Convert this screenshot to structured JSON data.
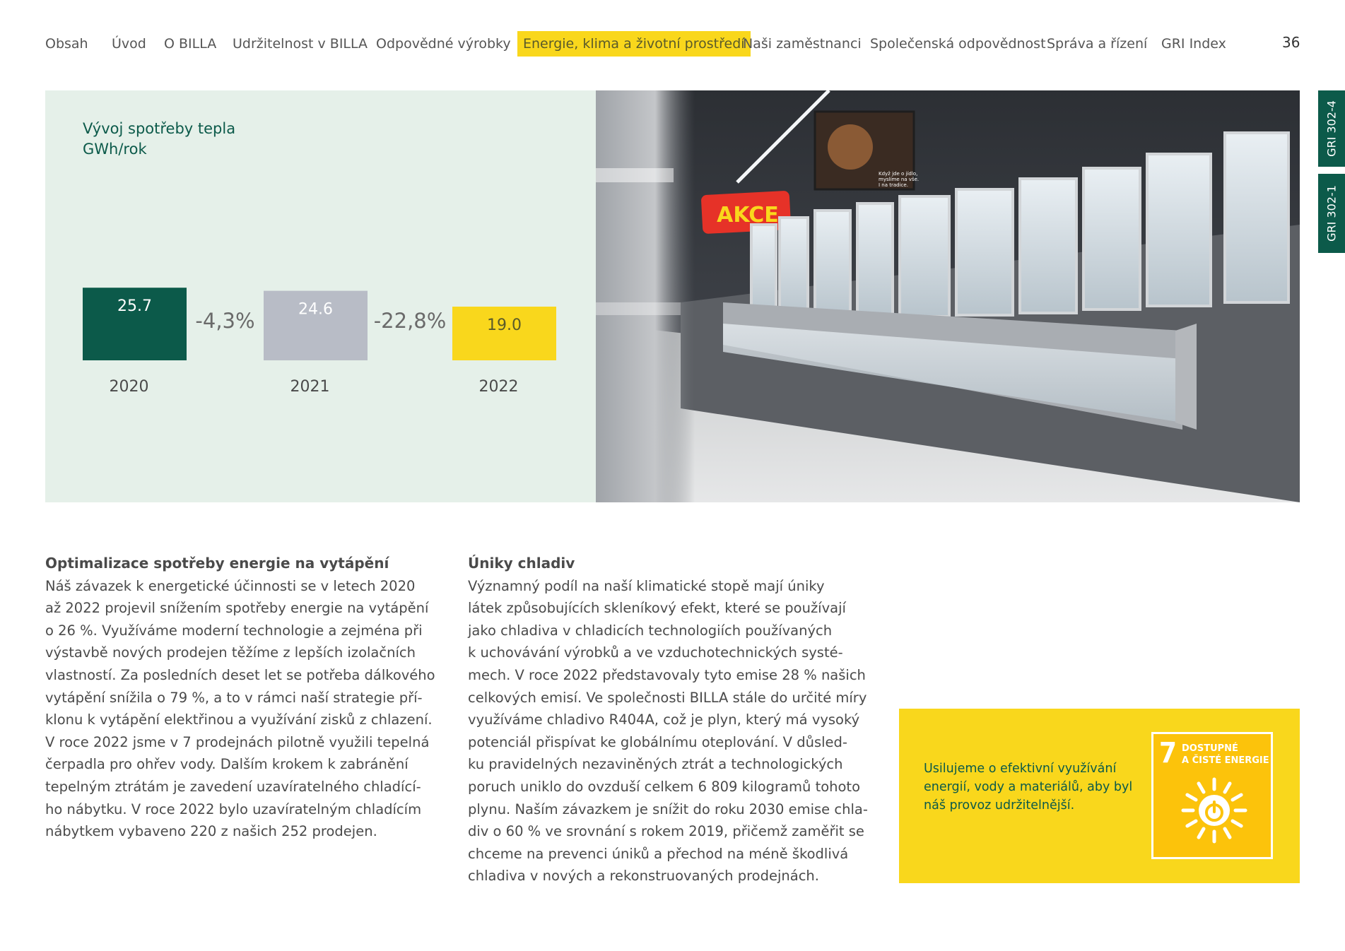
{
  "nav": {
    "items": [
      "Obsah",
      "Úvod",
      "O BILLA",
      "Udržitelnost v BILLA",
      "Odpovědné výrobky",
      "Energie, klima a životní prostředí",
      "Naši zaměstnanci",
      "Společenská odpovědnost",
      "Správa a řízení",
      "GRI Index"
    ],
    "active_index": 5,
    "page_number": "36"
  },
  "gri_tabs": [
    "GRI 302-4",
    "GRI 302-1"
  ],
  "chart_data": {
    "type": "bar",
    "title": "Vývoj spotřeby tepla",
    "ylabel": "GWh/rok",
    "categories": [
      "2020",
      "2021",
      "2022"
    ],
    "values": [
      25.7,
      24.6,
      19.0
    ],
    "value_labels": [
      "25.7",
      "24.6",
      "19.0"
    ],
    "changes": [
      "-4,3%",
      "-22,8%"
    ],
    "colors": [
      "#0c5a4a",
      "#b8bcc6",
      "#f9d71c"
    ],
    "label_colors": [
      "#ffffff",
      "#ffffff",
      "#5a5a2a"
    ]
  },
  "photo": {
    "sign_text": "AKCE",
    "screen_lines": [
      "Když jde o jídlo,",
      "myslíme na vše.",
      "I na tradice."
    ]
  },
  "sections": [
    {
      "heading": "Optimalizace spotřeby energie na vytápění",
      "body": "Náš závazek k energetické účinnosti se v letech 2020\naž 2022 projevil snížením spotřeby energie na vytápění\no 26 %. Využíváme moderní technologie a zejména při\nvýstavbě nových prodejen těžíme z lepších izolačních\nvlastností. Za posledních deset let se potřeba dálkového\nvytápění snížila o 79 %, a to v rámci naší strategie pří-\nklonu k vytápění elektřinou a využívání zisků z chlazení.\nV roce 2022 jsme v 7 prodejnách pilotně využili tepelná\nčerpadla pro ohřev vody. Dalším krokem k zabránění\ntepelným ztrátám je zavedení uzavíratelného chladící-\nho nábytku. V roce 2022 bylo uzavíratelným chladícím\nnábytkem vybaveno 220 z našich 252 prodejen."
    },
    {
      "heading": "Úniky chladiv",
      "body": "Významný podíl na naší klimatické stopě mají úniky\nlátek způsobujících skleníkový efekt, které se používají\njako chladiva v chladicích technologiích používaných\nk uchovávání výrobků a ve vzduchotechnických systé-\nmech. V roce 2022 představovaly tyto emise 28 % našich\ncelkových emisí. Ve společnosti BILLA stále do určité míry\nvyužíváme chladivo R404A, což je plyn, který má vysoký\npotenciál přispívat ke globálnímu oteplování. V důsled-\nku pravidelných nezaviněných ztrát a technologických\nporuch uniklo do ovzduší celkem 6 809 kilogramů tohoto\nplynu. Naším závazkem je snížit do roku 2030 emise chla-\ndiv o 60 % ve srovnání s rokem 2019, přičemž zaměřit se\nchceme na prevenci úniků a přechod na méně škodlivá\nchladiva v nových a rekonstruovaných prodejnách."
    }
  ],
  "sdg": {
    "text": "Usilujeme o efektivní využívání energií, vody a materiálů, aby byl náš provoz udržitelnější.",
    "number": "7",
    "label": "DOSTUPNÉ\nA ČISTÉ ENERGIE",
    "icon": "sun-power-icon"
  },
  "colors": {
    "brand_green": "#0c5a4a",
    "brand_yellow": "#f9d71c",
    "panel_bg": "#e5f0e9",
    "sdg_tile": "#fcc30b"
  }
}
